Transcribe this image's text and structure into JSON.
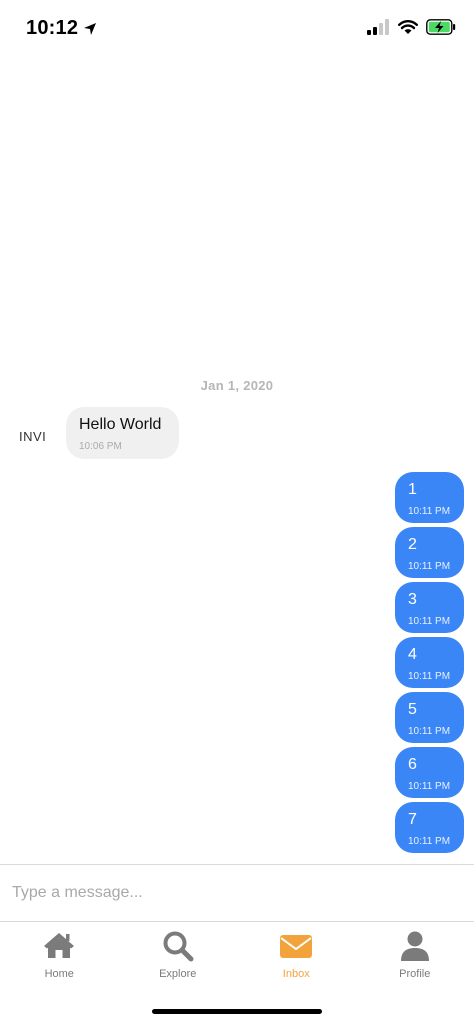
{
  "status_bar": {
    "time": "10:12",
    "icons": [
      "location-arrow-icon",
      "signal-icon",
      "wifi-icon",
      "battery-charging-icon"
    ]
  },
  "chat": {
    "date_label": "Jan 1, 2020",
    "incoming": {
      "sender": "INVI",
      "text": "Hello World",
      "time": "10:06 PM"
    },
    "outgoing": [
      {
        "text": "1",
        "time": "10:11 PM"
      },
      {
        "text": "2",
        "time": "10:11 PM"
      },
      {
        "text": "3",
        "time": "10:11 PM"
      },
      {
        "text": "4",
        "time": "10:11 PM"
      },
      {
        "text": "5",
        "time": "10:11 PM"
      },
      {
        "text": "6",
        "time": "10:11 PM"
      },
      {
        "text": "7",
        "time": "10:11 PM"
      }
    ]
  },
  "composer": {
    "placeholder": "Type a message...",
    "value": ""
  },
  "tabs": [
    {
      "label": "Home",
      "icon": "home-icon",
      "active": false
    },
    {
      "label": "Explore",
      "icon": "search-icon",
      "active": false
    },
    {
      "label": "Inbox",
      "icon": "envelope-icon",
      "active": true
    },
    {
      "label": "Profile",
      "icon": "user-icon",
      "active": false
    }
  ],
  "colors": {
    "outgoing_bubble": "#3b86f7",
    "incoming_bubble": "#f0f0f0",
    "active_tab": "#f3a33b",
    "inactive_tab": "#7b7b7b"
  }
}
